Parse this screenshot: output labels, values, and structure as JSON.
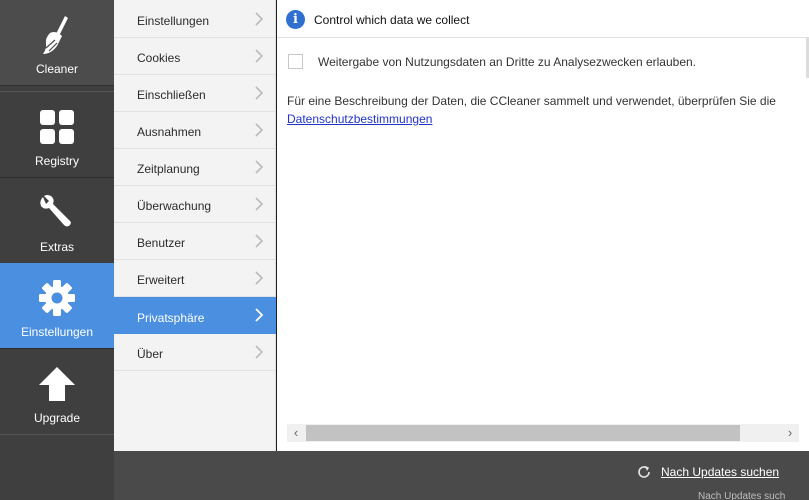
{
  "sidebar": {
    "items": [
      {
        "label": "Cleaner",
        "icon": "broom-icon"
      },
      {
        "label": "Registry",
        "icon": "grid-icon"
      },
      {
        "label": "Extras",
        "icon": "wrench-icon"
      },
      {
        "label": "Einstellungen",
        "icon": "gear-icon"
      },
      {
        "label": "Upgrade",
        "icon": "upload-arrow-icon"
      }
    ],
    "active": "Einstellungen"
  },
  "submenu": {
    "items": [
      {
        "label": "Einstellungen"
      },
      {
        "label": "Cookies"
      },
      {
        "label": "Einschließen"
      },
      {
        "label": "Ausnahmen"
      },
      {
        "label": "Zeitplanung"
      },
      {
        "label": "Überwachung"
      },
      {
        "label": "Benutzer"
      },
      {
        "label": "Erweitert"
      },
      {
        "label": "Privatsphäre"
      },
      {
        "label": "Über"
      }
    ],
    "active": "Privatsphäre"
  },
  "main": {
    "header_title": "Control which data we collect",
    "consent_label": "Weitergabe von Nutzungsdaten an Dritte zu Analysezwecken erlauben.",
    "consent_checked": false,
    "description": "Für eine Beschreibung der Daten, die CCleaner sammelt und verwendet, überprüfen Sie die",
    "privacy_link": "Datenschutzbestimmungen",
    "scroll_left": "‹",
    "scroll_right": "›"
  },
  "bottombar": {
    "update_link": "Nach Updates suchen",
    "edge_text": "Nach Updates such"
  },
  "colors": {
    "accent": "#4a8fe0",
    "sidebar_bg": "#3f3f3f",
    "bottombar_bg": "#4a4a4a"
  }
}
